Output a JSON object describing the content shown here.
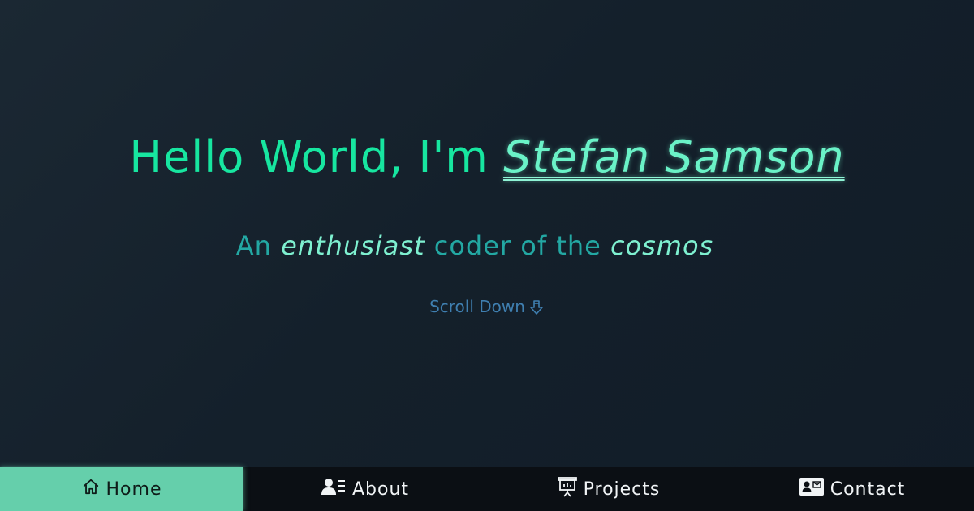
{
  "hero": {
    "greeting": "Hello World, I'm ",
    "name": "Stefan Samson",
    "tagline": {
      "part1": "An ",
      "emph1": "enthusiast",
      "part2": " coder of the ",
      "emph2": "cosmos"
    },
    "scroll_label": "Scroll Down"
  },
  "nav": {
    "active": "Home",
    "items": [
      {
        "label": "Home",
        "icon": "home-icon"
      },
      {
        "label": "About",
        "icon": "user-details-icon"
      },
      {
        "label": "Projects",
        "icon": "presentation-icon"
      },
      {
        "label": "Contact",
        "icon": "contact-card-icon"
      }
    ]
  },
  "colors": {
    "greeting": "#17e6a0",
    "name": "#6af2c7",
    "tagline": "#23a8a3",
    "tagline_emphasis": "#7ef0d0",
    "scroll": "#3f7fb0",
    "nav_background": "#0b0f14",
    "nav_active": "#65cfab"
  }
}
